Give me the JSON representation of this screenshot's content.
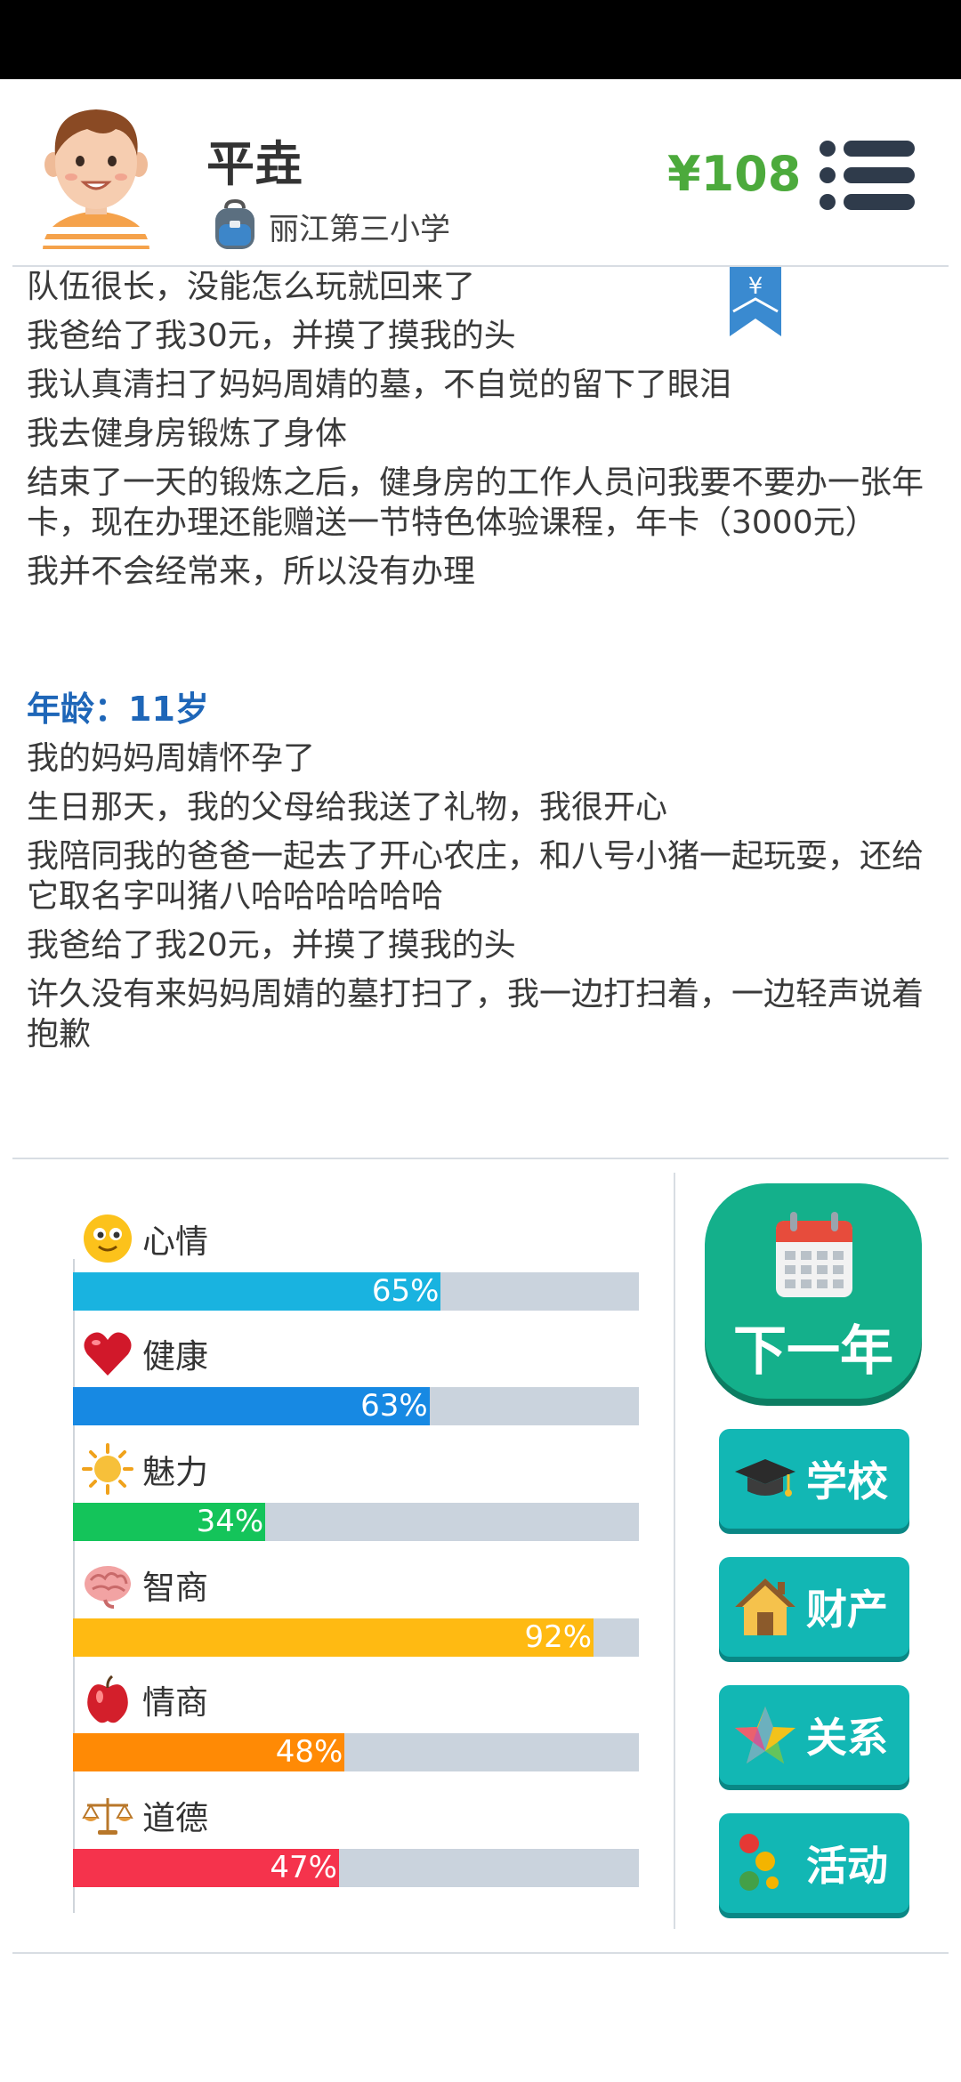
{
  "player": {
    "name": "平垚",
    "school": "丽江第三小学",
    "money": "¥108"
  },
  "bookmark_symbol": "¥",
  "log": {
    "lines_prev": [
      "队伍很长，没能怎么玩就回来了",
      "我爸给了我30元，并摸了摸我的头",
      "我认真清扫了妈妈周婧的墓，不自觉的留下了眼泪",
      "我去健身房锻炼了身体",
      "结束了一天的锻炼之后，健身房的工作人员问我要不要办一张年卡，现在办理还能赠送一节特色体验课程，年卡（3000元）",
      "我并不会经常来，所以没有办理"
    ],
    "age_label": "年龄：11岁",
    "lines_age11": [
      "我的妈妈周婧怀孕了",
      "生日那天，我的父母给我送了礼物，我很开心",
      "我陪同我的爸爸一起去了开心农庄，和八号小猪一起玩耍，还给它取名字叫猪八哈哈哈哈哈哈",
      "我爸给了我20元，并摸了摸我的头",
      "许久没有来妈妈周婧的墓打扫了，我一边打扫着，一边轻声说着抱歉"
    ]
  },
  "stats": [
    {
      "label": "心情",
      "icon": "smiley-icon",
      "value": 65,
      "pct_text": "65%",
      "color": "#19b3e0"
    },
    {
      "label": "健康",
      "icon": "heart-icon",
      "value": 63,
      "pct_text": "63%",
      "color": "#1789e3"
    },
    {
      "label": "魅力",
      "icon": "sun-icon",
      "value": 34,
      "pct_text": "34%",
      "color": "#14c45a"
    },
    {
      "label": "智商",
      "icon": "brain-icon",
      "value": 92,
      "pct_text": "92%",
      "color": "#ffba12"
    },
    {
      "label": "情商",
      "icon": "apple-icon",
      "value": 48,
      "pct_text": "48%",
      "color": "#ff8a05"
    },
    {
      "label": "道德",
      "icon": "scales-icon",
      "value": 47,
      "pct_text": "47%",
      "color": "#f5334c"
    }
  ],
  "buttons": {
    "next_year": "下一年",
    "school": "学校",
    "property": "财产",
    "relations": "关系",
    "activities": "活动"
  },
  "colors": {
    "money": "#4caa3c",
    "age_heading": "#1e66b8",
    "next_year_bg": "#14b08b",
    "side_button_bg": "#12b7b4",
    "bar_track": "#cad3dd"
  }
}
